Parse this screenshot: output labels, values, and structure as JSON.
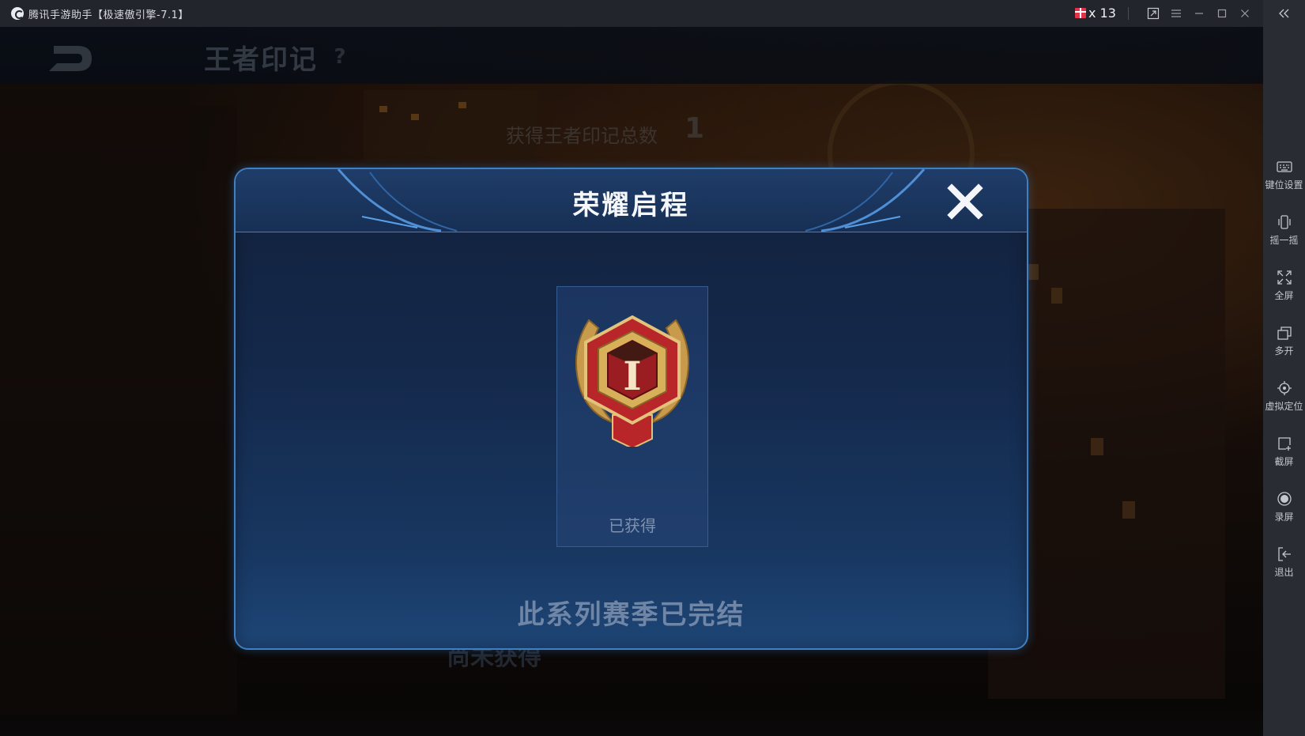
{
  "window": {
    "title": "腾讯手游助手【极速傲引擎-7.1】",
    "gift_count": "x 13"
  },
  "sidebar": {
    "items": [
      {
        "label": "键位设置",
        "icon": "keyboard-icon"
      },
      {
        "label": "摇一摇",
        "icon": "shake-icon"
      },
      {
        "label": "全屏",
        "icon": "fullscreen-icon"
      },
      {
        "label": "多开",
        "icon": "multi-instance-icon"
      },
      {
        "label": "虚拟定位",
        "icon": "location-icon"
      },
      {
        "label": "截屏",
        "icon": "screenshot-icon"
      },
      {
        "label": "录屏",
        "icon": "record-icon"
      },
      {
        "label": "退出",
        "icon": "exit-icon"
      }
    ]
  },
  "game": {
    "page_title": "王者印记",
    "help": "?",
    "total_label": "获得王者印记总数",
    "total_value": "1",
    "not_obtained": "尚未获得"
  },
  "modal": {
    "title": "荣耀启程",
    "card": {
      "badge_numeral": "I",
      "status": "已获得"
    },
    "footer": "此系列赛季已完结"
  },
  "colors": {
    "accent_blue": "#3f7fc3",
    "modal_bg": "#14284a",
    "badge_red": "#b8262a",
    "badge_gold": "#d9b05a"
  }
}
